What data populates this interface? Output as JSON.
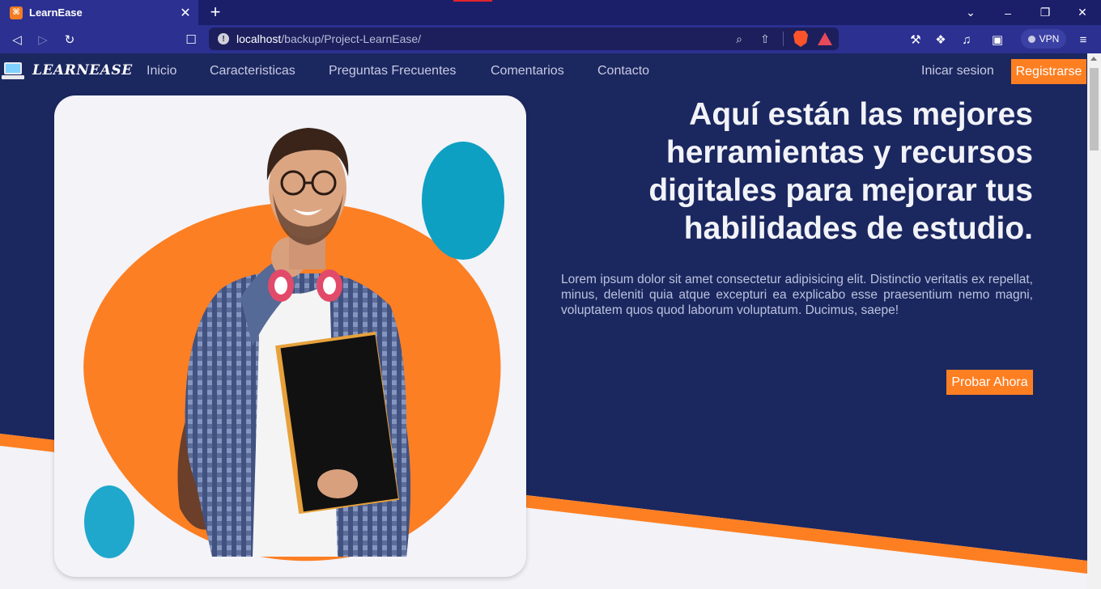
{
  "browser": {
    "tab_title": "LearnEase",
    "tab_favicon": "xampp-icon",
    "url_host": "localhost",
    "url_path": "/backup/Project-LearnEase/",
    "vpn_label": "VPN"
  },
  "site": {
    "brand": "LEARNEASE",
    "nav": [
      "Inicio",
      "Caracteristicas",
      "Preguntas Frecuentes",
      "Comentarios",
      "Contacto"
    ],
    "login_label": "Inicar sesion",
    "register_label": "Registrarse"
  },
  "hero": {
    "headline": "Aquí están las mejores herramientas y recursos digitales para mejorar tus habilidades de estudio.",
    "description": "Lorem ipsum dolor sit amet consectetur adipisicing elit. Distinctio veritatis ex repellat, minus, deleniti quia atque excepturi ea explicabo esse praesentium nemo magni, voluptatem quos quod laborum voluptatum. Ducimus, saepe!",
    "cta_label": "Probar Ahora"
  },
  "colors": {
    "browser_tabbar": "#1b1f6a",
    "browser_toolbar": "#2b3091",
    "nav_bg": "#1b275f",
    "hero_bg": "#1b275f",
    "accent_orange": "#fd7f22",
    "accent_teal": "#0da0c3"
  }
}
